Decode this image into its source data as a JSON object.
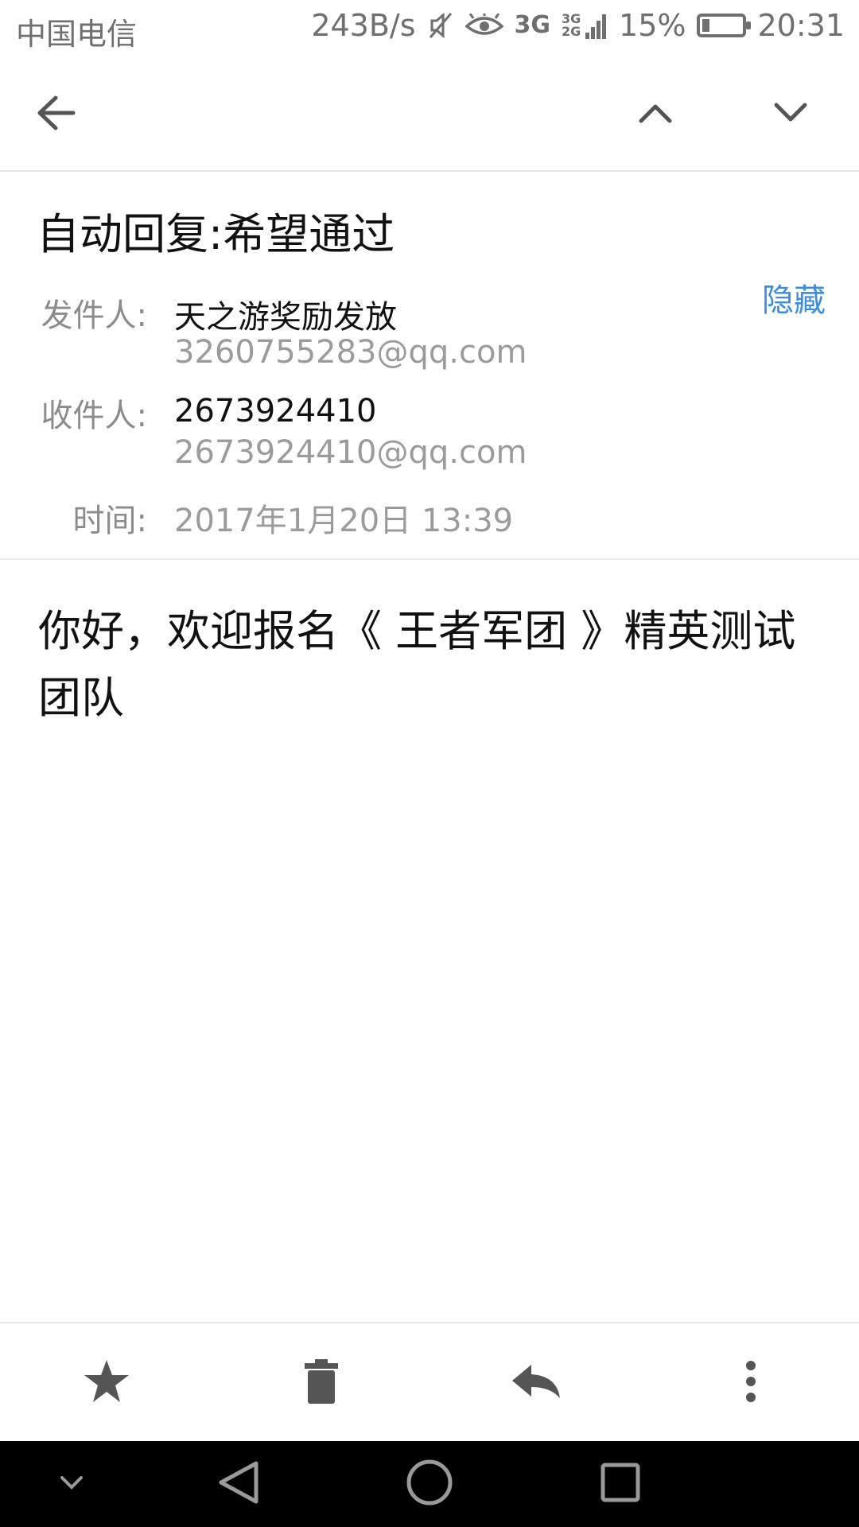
{
  "status_bar": {
    "carrier": "中国电信",
    "net_speed": "243B/s",
    "network_3g": "3G",
    "network_3g2g": "3G 2G",
    "battery": "15%",
    "time": "20:31",
    "battery_level": 0.15
  },
  "app_bar": {
    "back_icon": "arrow-left-icon",
    "prev_icon": "chevron-up-icon",
    "next_icon": "chevron-down-icon"
  },
  "email": {
    "subject": "自动回复:希望通过",
    "hide_label": "隐藏",
    "from_label": "发件人:",
    "from_name": "天之游奖励发放",
    "from_address": "3260755283@qq.com",
    "to_label": "收件人:",
    "to_name": "2673924410",
    "to_address": "2673924410@qq.com",
    "time_label": "时间:",
    "time_value": "2017年1月20日 13:39",
    "body": "你好，欢迎报名《 王者军团 》精英测试团队"
  },
  "toolbar": {
    "star_icon": "star-icon",
    "delete_icon": "trash-icon",
    "reply_icon": "reply-icon",
    "more_icon": "more-vertical-icon"
  },
  "nav_bar": {
    "collapse_icon": "chevron-down-icon",
    "back_icon": "triangle-back-icon",
    "home_icon": "circle-home-icon",
    "recents_icon": "square-recents-icon"
  },
  "colors": {
    "accent": "#3b8de0",
    "label_gray": "#8c8c8c",
    "nav_background": "#000000"
  }
}
